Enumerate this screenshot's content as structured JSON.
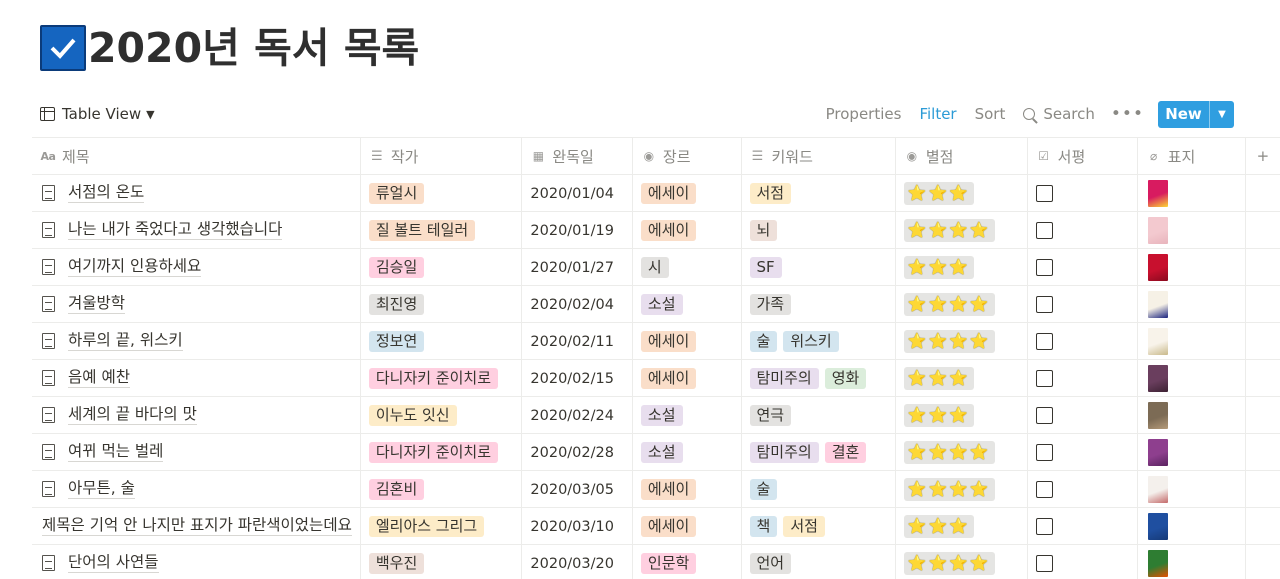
{
  "page": {
    "title": "2020년 독서 목록",
    "title_icon": "checkbox-icon"
  },
  "toolbar": {
    "view_label": "Table View",
    "properties": "Properties",
    "filter": "Filter",
    "sort": "Sort",
    "search": "Search",
    "more": "•••",
    "new": "New"
  },
  "columns": [
    {
      "label": "제목",
      "icon": "title-icon"
    },
    {
      "label": "작가",
      "icon": "multiselect-icon"
    },
    {
      "label": "완독일",
      "icon": "calendar-icon"
    },
    {
      "label": "장르",
      "icon": "select-icon"
    },
    {
      "label": "키워드",
      "icon": "multiselect-icon"
    },
    {
      "label": "별점",
      "icon": "select-icon"
    },
    {
      "label": "서평",
      "icon": "checkbox-icon"
    },
    {
      "label": "표지",
      "icon": "attachment-icon"
    }
  ],
  "colors": {
    "accent": "#2f9ee0",
    "tag_orange": "#fadec9",
    "tag_red": "#ffcfe0",
    "tag_gray": "#e3e2e0",
    "tag_blue": "#d3e5ef",
    "tag_yellow": "#fdecc8",
    "tag_purple": "#e8deee",
    "tag_brown": "#eee0da",
    "tag_green": "#dbeddb"
  },
  "rows": [
    {
      "title": "서점의 온도",
      "author": "류얼시",
      "author_color": "#fadec9",
      "date": "2020/01/04",
      "genre": "에세이",
      "genre_color": "#fadec9",
      "keywords": [
        {
          "text": "서점",
          "color": "#fdecc8"
        }
      ],
      "stars": "⭐⭐⭐",
      "review": false,
      "cover_colors": [
        "#d81b60",
        "#fdd835"
      ]
    },
    {
      "title": "나는 내가 죽었다고 생각했습니다",
      "author": "질 볼트 테일러",
      "author_color": "#fadec9",
      "date": "2020/01/19",
      "genre": "에세이",
      "genre_color": "#fadec9",
      "keywords": [
        {
          "text": "뇌",
          "color": "#eee0da"
        }
      ],
      "stars": "⭐⭐⭐⭐",
      "review": false,
      "cover_colors": [
        "#f3c9cf",
        "#e8b4bc"
      ]
    },
    {
      "title": "여기까지 인용하세요",
      "author": "김승일",
      "author_color": "#ffcfe0",
      "date": "2020/01/27",
      "genre": "시",
      "genre_color": "#e3e2e0",
      "keywords": [
        {
          "text": "SF",
          "color": "#e8deee"
        }
      ],
      "stars": "⭐⭐⭐",
      "review": false,
      "cover_colors": [
        "#c8102e",
        "#8b0a1f"
      ]
    },
    {
      "title": "겨울방학",
      "author": "최진영",
      "author_color": "#e3e2e0",
      "date": "2020/02/04",
      "genre": "소설",
      "genre_color": "#e8deee",
      "keywords": [
        {
          "text": "가족",
          "color": "#e3e2e0"
        }
      ],
      "stars": "⭐⭐⭐⭐",
      "review": false,
      "cover_colors": [
        "#f6f1e6",
        "#1a237e"
      ]
    },
    {
      "title": "하루의 끝, 위스키",
      "author": "정보연",
      "author_color": "#d3e5ef",
      "date": "2020/02/11",
      "genre": "에세이",
      "genre_color": "#fadec9",
      "keywords": [
        {
          "text": "술",
          "color": "#d3e5ef"
        },
        {
          "text": "위스키",
          "color": "#d3e5ef"
        }
      ],
      "stars": "⭐⭐⭐⭐",
      "review": false,
      "cover_colors": [
        "#f8f3ea",
        "#c9b98a"
      ]
    },
    {
      "title": "음예 예찬",
      "author": "다니자키 준이치로",
      "author_color": "#ffcfe0",
      "date": "2020/02/15",
      "genre": "에세이",
      "genre_color": "#fadec9",
      "keywords": [
        {
          "text": "탐미주의",
          "color": "#e8deee"
        },
        {
          "text": "영화",
          "color": "#dbeddb"
        }
      ],
      "stars": "⭐⭐⭐",
      "review": false,
      "cover_colors": [
        "#6a3e5e",
        "#3d2233"
      ]
    },
    {
      "title": "세계의 끝 바다의 맛",
      "author": "이누도 잇신",
      "author_color": "#fdecc8",
      "date": "2020/02/24",
      "genre": "소설",
      "genre_color": "#e8deee",
      "keywords": [
        {
          "text": "연극",
          "color": "#e3e2e0"
        }
      ],
      "stars": "⭐⭐⭐",
      "review": false,
      "cover_colors": [
        "#7c6b55",
        "#b59b7a"
      ]
    },
    {
      "title": "여뀌 먹는 벌레",
      "author": "다니자키 준이치로",
      "author_color": "#ffcfe0",
      "date": "2020/02/28",
      "genre": "소설",
      "genre_color": "#e8deee",
      "keywords": [
        {
          "text": "탐미주의",
          "color": "#e8deee"
        },
        {
          "text": "결혼",
          "color": "#ffcfe0"
        }
      ],
      "stars": "⭐⭐⭐⭐",
      "review": false,
      "cover_colors": [
        "#8e3f8e",
        "#5a2360"
      ]
    },
    {
      "title": "아무튼, 술",
      "author": "김혼비",
      "author_color": "#ffcfe0",
      "date": "2020/03/05",
      "genre": "에세이",
      "genre_color": "#fadec9",
      "keywords": [
        {
          "text": "술",
          "color": "#d3e5ef"
        }
      ],
      "stars": "⭐⭐⭐⭐",
      "review": false,
      "cover_colors": [
        "#f4f0ec",
        "#c46a6a"
      ]
    },
    {
      "title": "제목은 기억 안 나지만 표지가 파란색이었는데요",
      "author": "엘리아스 그리그",
      "author_color": "#fdecc8",
      "date": "2020/03/10",
      "genre": "에세이",
      "genre_color": "#fadec9",
      "keywords": [
        {
          "text": "책",
          "color": "#d3e5ef"
        },
        {
          "text": "서점",
          "color": "#fdecc8"
        }
      ],
      "stars": "⭐⭐⭐",
      "review": false,
      "cover_colors": [
        "#1f4fa0",
        "#163a78"
      ],
      "no_icon": true
    },
    {
      "title": "단어의 사연들",
      "author": "백우진",
      "author_color": "#eee0da",
      "date": "2020/03/20",
      "genre": "인문학",
      "genre_color": "#ffcfe0",
      "keywords": [
        {
          "text": "언어",
          "color": "#e3e2e0"
        }
      ],
      "stars": "⭐⭐⭐⭐",
      "review": false,
      "cover_colors": [
        "#2e7d32",
        "#e65100"
      ]
    }
  ]
}
